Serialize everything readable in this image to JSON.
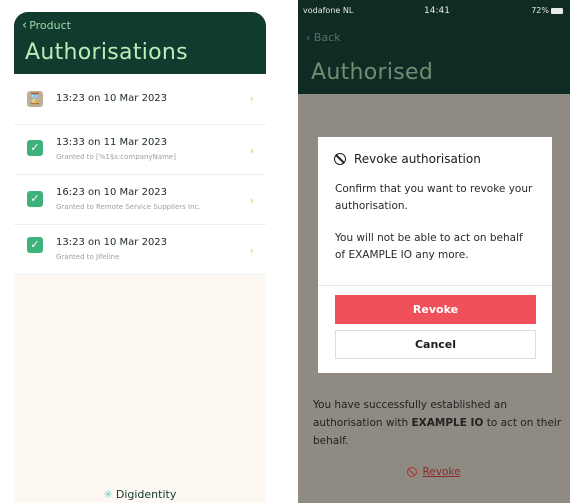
{
  "left": {
    "back_label": "Product",
    "title": "Authorisations",
    "items": [
      {
        "date": "13:23 on 10 Mar 2023",
        "sub": "",
        "status": "pending"
      },
      {
        "date": "13:33 on 11 Mar 2023",
        "sub": "Granted to [%1$s:companyName]",
        "status": "granted"
      },
      {
        "date": "16:23 on 10 Mar 2023",
        "sub": "Granted to Remote Service Suppliers Inc.",
        "status": "granted"
      },
      {
        "date": "13:23 on 10 Mar 2023",
        "sub": "Granted to Jifeline",
        "status": "granted"
      }
    ],
    "brand": "Digidentity",
    "colors": {
      "header": "#123b30",
      "title": "#b7efb8",
      "granted": "#3db27a",
      "pending": "#bfae9a",
      "arrow": "#e8c06a"
    }
  },
  "right": {
    "status_bar": {
      "carrier": "vodafone NL",
      "time": "14:41",
      "battery": "72%"
    },
    "back_label": "Back",
    "title": "Authorised",
    "dialog": {
      "title": "Revoke authorisation",
      "body1": "Confirm that you want to revoke your authorisation.",
      "body2": "You will not be able to act on behalf of EXAMPLE IO any more.",
      "revoke_label": "Revoke",
      "cancel_label": "Cancel"
    },
    "info": {
      "pre": "You have successfully established an authorisation with ",
      "company": "EXAMPLE IO",
      "post": " to act on their behalf."
    },
    "revoke_link": "Revoke",
    "colors": {
      "revoke_button": "#f0505a",
      "link": "#8c2a2a"
    }
  }
}
